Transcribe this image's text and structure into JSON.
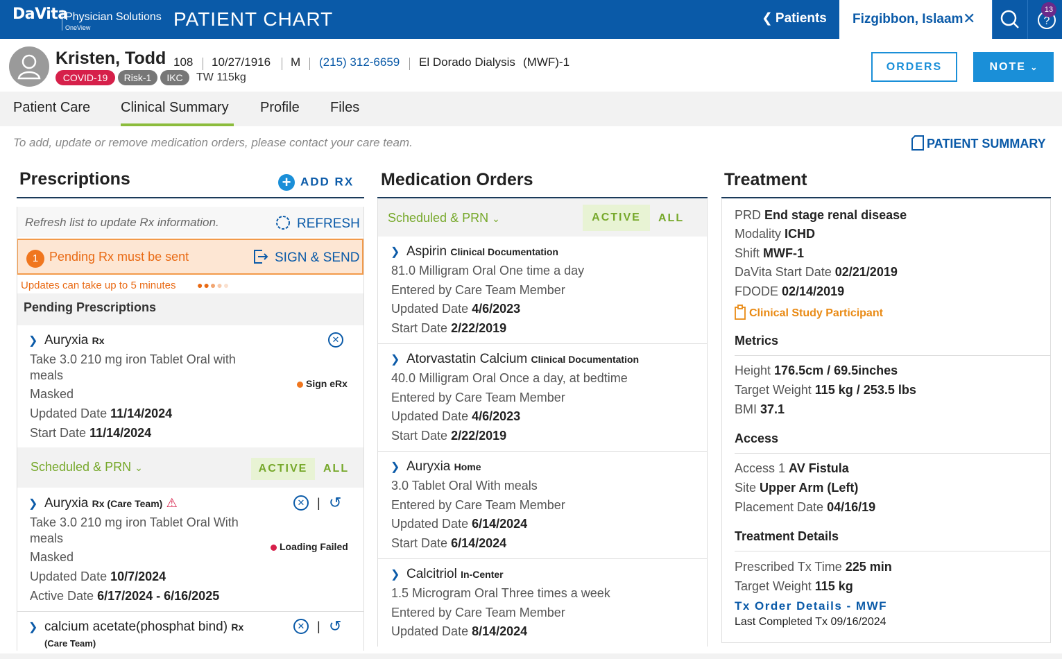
{
  "header": {
    "logo": "DaVita",
    "logo_sub": "Physician Solutions",
    "logo_sub2": "OneView",
    "app_title": "PATIENT CHART",
    "back_label": "Patients",
    "open_patient_tab": "Fizgibbon, Islaam",
    "notification_count": "13"
  },
  "patient": {
    "name": "Kristen, Todd",
    "age": "108",
    "dob": "10/27/1916",
    "sex": "M",
    "phone": "(215) 312-6659",
    "facility": "El Dorado Dialysis",
    "schedule": "(MWF)-1",
    "tags": [
      "COVID-19",
      "Risk-1",
      "IKC"
    ],
    "tw": "TW 115kg"
  },
  "actions": {
    "orders": "ORDERS",
    "note": "NOTE"
  },
  "tabs": [
    "Patient Care",
    "Clinical Summary",
    "Profile",
    "Files"
  ],
  "notice": "To add, update or remove medication orders, please contact your care team.",
  "patient_summary": "PATIENT SUMMARY",
  "prescriptions": {
    "title": "Prescriptions",
    "add_rx": "ADD RX",
    "refresh_text": "Refresh list to update Rx information.",
    "refresh_btn": "REFRESH",
    "pending_count": "1",
    "pending_text": "Pending Rx must be sent",
    "sign_send": "SIGN & SEND",
    "updates_text": "Updates can take up to 5 minutes",
    "pending_heading": "Pending Prescriptions",
    "pending_item": {
      "name": "Auryxia",
      "type": "Rx",
      "line1": "Take 3.0 210 mg iron Tablet Oral with",
      "line2": "meals",
      "masked": "Masked",
      "updated_label": "Updated Date",
      "updated": "11/14/2024",
      "start_label": "Start Date",
      "start": "11/14/2024",
      "status": "Sign eRx"
    },
    "filter": "Scheduled & PRN",
    "active": "ACTIVE",
    "all": "ALL",
    "item2": {
      "name": "Auryxia",
      "type": "Rx (Care Team)",
      "line1": "Take 3.0 210 mg iron Tablet Oral With",
      "line2": "meals",
      "masked": "Masked",
      "updated_label": "Updated Date",
      "updated": "10/7/2024",
      "active_label": "Active Date",
      "active": "6/17/2024 - 6/16/2025",
      "status": "Loading Failed"
    },
    "item3": {
      "name": "calcium acetate(phosphat bind)",
      "type": "Rx",
      "type2": "(Care Team)"
    }
  },
  "medication_orders": {
    "title": "Medication Orders",
    "filter": "Scheduled & PRN",
    "active": "ACTIVE",
    "all": "ALL",
    "items": [
      {
        "name": "Aspirin",
        "type": "Clinical Documentation",
        "dose": "81.0 Milligram Oral One time a day",
        "entered": "Entered by Care Team Member",
        "updated_label": "Updated Date",
        "updated": "4/6/2023",
        "start_label": "Start Date",
        "start": "2/22/2019"
      },
      {
        "name": "Atorvastatin Calcium",
        "type": "Clinical Documentation",
        "dose": "40.0 Milligram Oral Once a day, at bedtime",
        "entered": "Entered by Care Team Member",
        "updated_label": "Updated Date",
        "updated": "4/6/2023",
        "start_label": "Start Date",
        "start": "2/22/2019"
      },
      {
        "name": "Auryxia",
        "type": "Home",
        "dose": "3.0 Tablet Oral With meals",
        "entered": "Entered by Care Team Member",
        "updated_label": "Updated Date",
        "updated": "6/14/2024",
        "start_label": "Start Date",
        "start": "6/14/2024"
      },
      {
        "name": "Calcitriol",
        "type": "In-Center",
        "dose": "1.5 Microgram Oral Three times a week",
        "entered": "Entered by Care Team Member",
        "updated_label": "Updated Date",
        "updated": "8/14/2024"
      }
    ]
  },
  "treatment": {
    "title": "Treatment",
    "prd_label": "PRD",
    "prd": "End stage renal disease",
    "modality_label": "Modality",
    "modality": "ICHD",
    "shift_label": "Shift",
    "shift": "MWF-1",
    "start_label": "DaVita Start Date",
    "start": "02/21/2019",
    "fdode_label": "FDODE",
    "fdode": "02/14/2019",
    "study": "Clinical Study Participant",
    "metrics_heading": "Metrics",
    "height_label": "Height",
    "height": "176.5cm / 69.5inches",
    "tweight_label": "Target Weight",
    "tweight": "115 kg / 253.5 lbs",
    "bmi_label": "BMI",
    "bmi": "37.1",
    "access_heading": "Access",
    "access1_label": "Access 1",
    "access1": "AV Fistula",
    "site_label": "Site",
    "site": "Upper Arm (Left)",
    "placement_label": "Placement Date",
    "placement": "04/16/19",
    "details_heading": "Treatment Details",
    "txtime_label": "Prescribed Tx Time",
    "txtime": "225 min",
    "tw2_label": "Target Weight",
    "tw2": "115 kg",
    "tx_order": "Tx Order Details - MWF",
    "last_completed": "Last Completed Tx 09/16/2024"
  }
}
